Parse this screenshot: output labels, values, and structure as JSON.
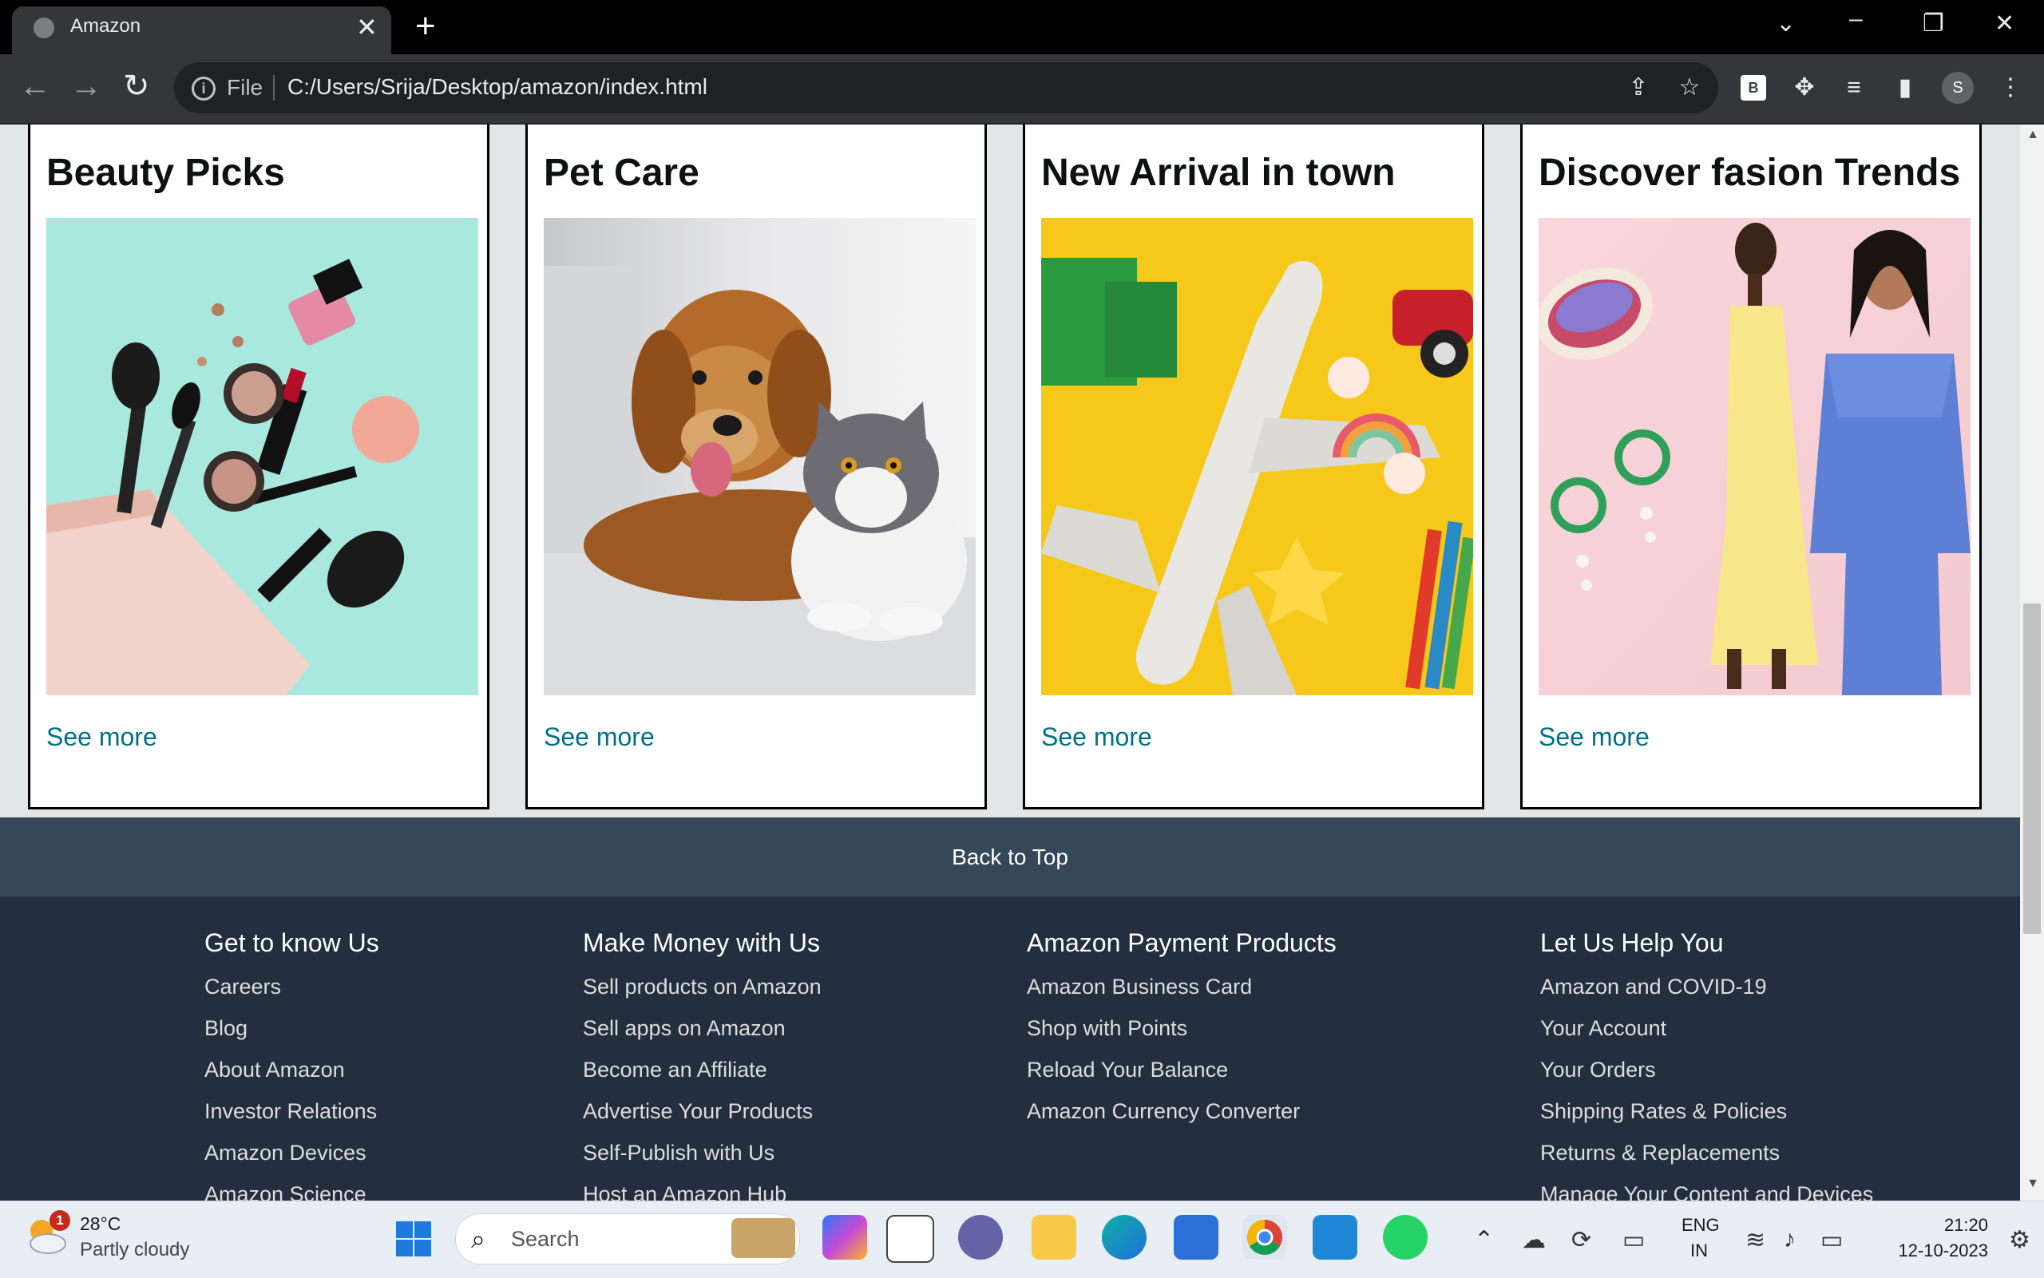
{
  "browser": {
    "tab_title": "Amazon",
    "tab_close": "✕",
    "new_tab": "+",
    "file_label": "File",
    "url": "C:/Users/Srija/Desktop/amazon/index.html",
    "profile_initial": "S",
    "extension_label": "B"
  },
  "cards": [
    {
      "title": "Beauty Picks",
      "link": "See more"
    },
    {
      "title": "Pet Care",
      "link": "See more"
    },
    {
      "title": "New Arrival in town",
      "link": "See more"
    },
    {
      "title": "Discover fasion Trends",
      "link": "See more"
    }
  ],
  "back_to_top": "Back to Top",
  "footer": {
    "columns": [
      {
        "title": "Get to know Us",
        "links": [
          "Careers",
          "Blog",
          "About Amazon",
          "Investor Relations",
          "Amazon Devices",
          "Amazon Science"
        ]
      },
      {
        "title": "Make Money with Us",
        "links": [
          "Sell products on Amazon",
          "Sell apps on Amazon",
          "Become an Affiliate",
          "Advertise Your Products",
          "Self-Publish with Us",
          "Host an Amazon Hub"
        ]
      },
      {
        "title": "Amazon Payment Products",
        "links": [
          "Amazon Business Card",
          "Shop with Points",
          "Reload Your Balance",
          "Amazon Currency Converter"
        ]
      },
      {
        "title": "Let Us Help You",
        "links": [
          "Amazon and COVID-19",
          "Your Account",
          "Your Orders",
          "Shipping Rates & Policies",
          "Returns & Replacements",
          "Manage Your Content and Devices"
        ]
      }
    ]
  },
  "taskbar": {
    "weather_temp": "28°C",
    "weather_desc": "Partly cloudy",
    "weather_badge": "1",
    "search_placeholder": "Search",
    "lang_line1": "ENG",
    "lang_line2": "IN",
    "time": "21:20",
    "date": "12-10-2023"
  },
  "colors": {
    "link": "#007185",
    "back_to_top_bg": "#37475a",
    "footer_bg": "#232f3e"
  }
}
